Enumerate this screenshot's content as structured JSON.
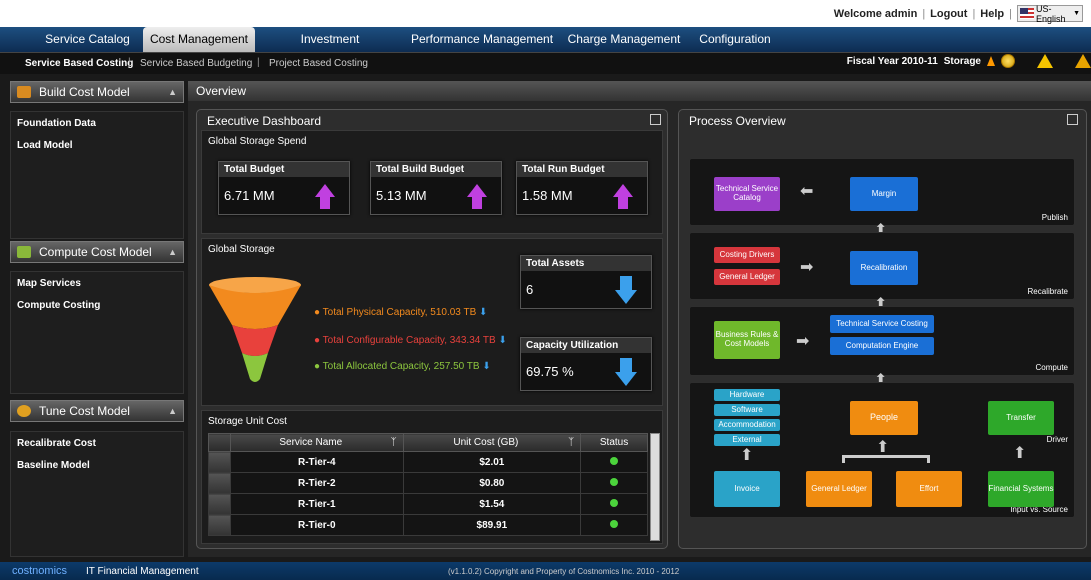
{
  "header": {
    "welcome": "Welcome admin",
    "logout": "Logout",
    "help": "Help",
    "language": "US-English"
  },
  "nav": {
    "tabs": [
      "Service Catalog",
      "Cost Management",
      "Investment Management",
      "Performance Management",
      "Charge Management",
      "Configuration"
    ],
    "active": "Cost Management"
  },
  "subnav": {
    "items": [
      "Service Based Costing",
      "Service Based Budgeting",
      "Project Based Costing"
    ],
    "fiscal": "Fiscal Year 2010-11",
    "storage": "Storage"
  },
  "sidebar": {
    "sections": [
      {
        "title": "Build Cost Model",
        "items": [
          "Foundation Data",
          "Load Model"
        ]
      },
      {
        "title": "Compute Cost Model",
        "items": [
          "Map Services",
          "Compute Costing"
        ]
      },
      {
        "title": "Tune Cost Model",
        "items": [
          "Recalibrate Cost",
          "Baseline Model"
        ]
      }
    ]
  },
  "overview": {
    "title": "Overview"
  },
  "dashboard": {
    "title": "Executive Dashboard",
    "spend_title": "Global Storage Spend",
    "kpis": [
      {
        "label": "Total Budget",
        "value": "6.71 MM"
      },
      {
        "label": "Total Build Budget",
        "value": "5.13 MM"
      },
      {
        "label": "Total Run Budget",
        "value": "1.58 MM"
      }
    ],
    "storage_title": "Global Storage",
    "legend": [
      {
        "text": "Total Physical Capacity, 510.03 TB",
        "color": "#f28a1e"
      },
      {
        "text": "Total Configurable Capacity, 343.34 TB",
        "color": "#e8413c"
      },
      {
        "text": "Total Allocated Capacity, 257.50 TB",
        "color": "#8cc63e"
      }
    ],
    "assets": {
      "label": "Total Assets",
      "value": "6"
    },
    "utilization": {
      "label": "Capacity Utilization",
      "value": "69.75 %"
    },
    "unit_cost_title": "Storage Unit Cost",
    "table": {
      "columns": [
        "Service Name",
        "Unit Cost (GB)",
        "Status"
      ],
      "rows": [
        [
          "R-Tier-4",
          "$2.01"
        ],
        [
          "R-Tier-2",
          "$0.80"
        ],
        [
          "R-Tier-1",
          "$1.54"
        ],
        [
          "R-Tier-0",
          "$89.91"
        ]
      ]
    }
  },
  "process": {
    "title": "Process Overview",
    "bands": [
      "Publish",
      "Recalibrate",
      "Compute",
      "Driver",
      "Input vs. Source"
    ],
    "boxes": {
      "tsc": "Technical Service Catalog",
      "margin": "Margin",
      "costing_drivers": "Costing Drivers",
      "general_ledger": "General Ledger",
      "recalibration": "Recalibration",
      "business_rules": "Business Rules & Cost Models",
      "tech_service_costing": "Technical Service Costing",
      "computation_engine": "Computation Engine",
      "hardware": "Hardware",
      "software": "Software",
      "accommodation": "Accommodation",
      "external": "External",
      "people": "People",
      "transfer": "Transfer",
      "invoice": "Invoice",
      "gl2": "General Ledger",
      "effort": "Effort",
      "financial_systems": "Financial Systems"
    }
  },
  "footer": {
    "brand": "costnomics",
    "product": "IT Financial Management",
    "copyright": "(v1.1.0.2) Copyright and Property of Costnomics Inc. 2010 - 2012"
  },
  "colors": {
    "nav": "#1d4f80",
    "purple": "#9b3fc9",
    "blue": "#1a6fd6",
    "red": "#d6363c",
    "green": "#6fb82b",
    "cyan": "#2aa3c8",
    "orange": "#f08c10",
    "bright_green": "#2ea82a"
  }
}
